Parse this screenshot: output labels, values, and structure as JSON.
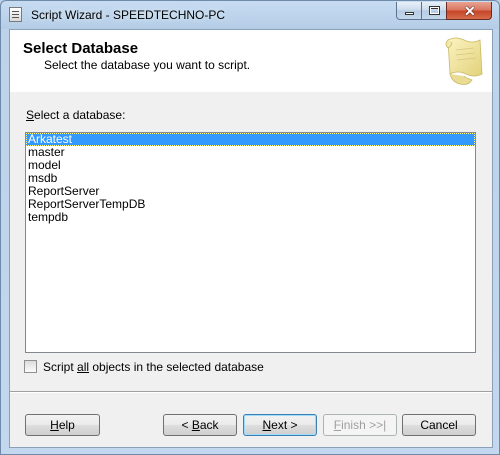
{
  "window": {
    "title": "Script Wizard - SPEEDTECHNO-PC"
  },
  "header": {
    "title": "Select Database",
    "subtitle": "Select the database you want to script."
  },
  "database_list": {
    "label_prefix": "",
    "label_accel": "S",
    "label_rest": "elect a database:",
    "items": [
      "Arkatest",
      "master",
      "model",
      "msdb",
      "ReportServer",
      "ReportServerTempDB",
      "tempdb"
    ],
    "selected": "Arkatest"
  },
  "script_all": {
    "label_pre": "Script ",
    "label_accel": "all",
    "label_post": " objects in the selected database",
    "checked": false
  },
  "buttons": {
    "help": {
      "pre": "",
      "accel": "H",
      "post": "elp"
    },
    "back": {
      "pre": "< ",
      "accel": "B",
      "post": "ack"
    },
    "next": {
      "pre": "",
      "accel": "N",
      "post": "ext >"
    },
    "finish": {
      "pre": "",
      "accel": "F",
      "post": "inish >>|"
    },
    "cancel": {
      "label": "Cancel"
    }
  },
  "colors": {
    "selection": "#3399ff",
    "header_bg": "#ffffff",
    "dialog_bg": "#f0f0f0",
    "close_button": "#c54327"
  }
}
